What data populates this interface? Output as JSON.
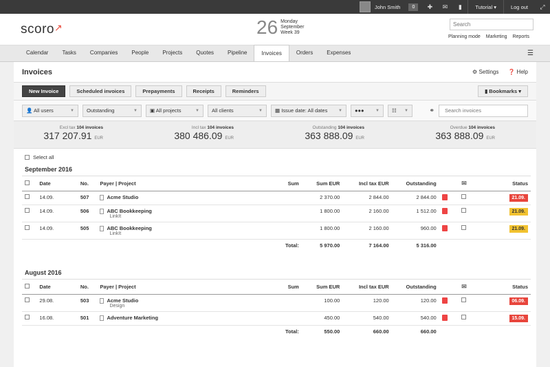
{
  "topbar": {
    "user": "John Smith",
    "count": "0",
    "tutorial": "Tutorial",
    "logout": "Log out"
  },
  "header": {
    "logo": "scoro",
    "day": "26",
    "weekday": "Monday",
    "month": "September",
    "week": "Week 39",
    "search_placeholder": "Search",
    "links": [
      "Planning mode",
      "Marketing",
      "Reports"
    ]
  },
  "nav": {
    "tabs": [
      "Calendar",
      "Tasks",
      "Companies",
      "People",
      "Projects",
      "Quotes",
      "Pipeline",
      "Invoices",
      "Orders",
      "Expenses"
    ],
    "active": 7
  },
  "page": {
    "title": "Invoices",
    "settings": "Settings",
    "help": "Help"
  },
  "buttons": {
    "new": "New Invoice",
    "scheduled": "Scheduled invoices",
    "prepayments": "Prepayments",
    "receipts": "Receipts",
    "reminders": "Reminders",
    "bookmarks": "Bookmarks"
  },
  "filters": {
    "users": "All users",
    "status": "Outstanding",
    "projects": "All projects",
    "clients": "All clients",
    "issue": "Issue date: All dates",
    "more": "●●●",
    "search_placeholder": "Search invoices"
  },
  "totals": [
    {
      "label": "Excl tax",
      "count": "104 invoices",
      "value": "317 207.91",
      "cur": "EUR"
    },
    {
      "label": "Incl tax",
      "count": "104 invoices",
      "value": "380 486.09",
      "cur": "EUR"
    },
    {
      "label": "Outstanding",
      "count": "104 invoices",
      "value": "363 888.09",
      "cur": "EUR"
    },
    {
      "label": "Overdue",
      "count": "104 invoices",
      "value": "363 888.09",
      "cur": "EUR"
    }
  ],
  "select_all": "Select all",
  "columns": {
    "date": "Date",
    "no": "No.",
    "payer": "Payer | Project",
    "sum": "Sum",
    "sum_eur": "Sum EUR",
    "incl": "Incl tax EUR",
    "out": "Outstanding",
    "status": "Status"
  },
  "groups": [
    {
      "month": "September 2016",
      "rows": [
        {
          "date": "14.09.",
          "no": "507",
          "payer": "Acme Studio",
          "project": "",
          "sum_eur": "2 370.00",
          "incl": "2 844.00",
          "out": "2 844.00",
          "status": "21.09.",
          "color": "red"
        },
        {
          "date": "14.09.",
          "no": "506",
          "payer": "ABC Bookkeeping",
          "project": "LinkIt",
          "sum_eur": "1 800.00",
          "incl": "2 160.00",
          "out": "1 512.00",
          "status": "21.09.",
          "color": "yel"
        },
        {
          "date": "14.09.",
          "no": "505",
          "payer": "ABC Bookkeeping",
          "project": "LinkIt",
          "sum_eur": "1 800.00",
          "incl": "2 160.00",
          "out": "960.00",
          "status": "21.09.",
          "color": "yel"
        }
      ],
      "total_label": "Total:",
      "total_sum": "5 970.00",
      "total_incl": "7 164.00",
      "total_out": "5 316.00"
    },
    {
      "month": "August 2016",
      "rows": [
        {
          "date": "29.08.",
          "no": "503",
          "payer": "Acme Studio",
          "project": "Design",
          "sum_eur": "100.00",
          "incl": "120.00",
          "out": "120.00",
          "status": "06.09.",
          "color": "red"
        },
        {
          "date": "16.08.",
          "no": "501",
          "payer": "Adventure Marketing",
          "project": "",
          "sum_eur": "450.00",
          "incl": "540.00",
          "out": "540.00",
          "status": "15.09.",
          "color": "red"
        }
      ],
      "total_label": "Total:",
      "total_sum": "550.00",
      "total_incl": "660.00",
      "total_out": "660.00"
    }
  ]
}
